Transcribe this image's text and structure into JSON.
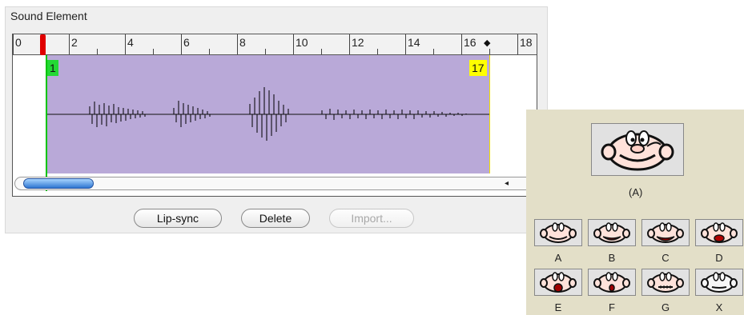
{
  "window": {
    "title": "Sound Element"
  },
  "timeline": {
    "ruler_labels": [
      "0",
      "2",
      "4",
      "6",
      "8",
      "10",
      "12",
      "14",
      "16",
      "18"
    ],
    "start_frame": "1",
    "end_frame": "17"
  },
  "buttons": {
    "lip_sync": "Lip-sync",
    "delete": "Delete",
    "import": "Import..."
  },
  "mouth_set": {
    "selected_label": "(A)",
    "labels": [
      "A",
      "B",
      "C",
      "D",
      "E",
      "F",
      "G",
      "X"
    ]
  },
  "icons": {
    "left_arrow": "◂",
    "right_arrow": "▸",
    "diamond": "◆"
  }
}
